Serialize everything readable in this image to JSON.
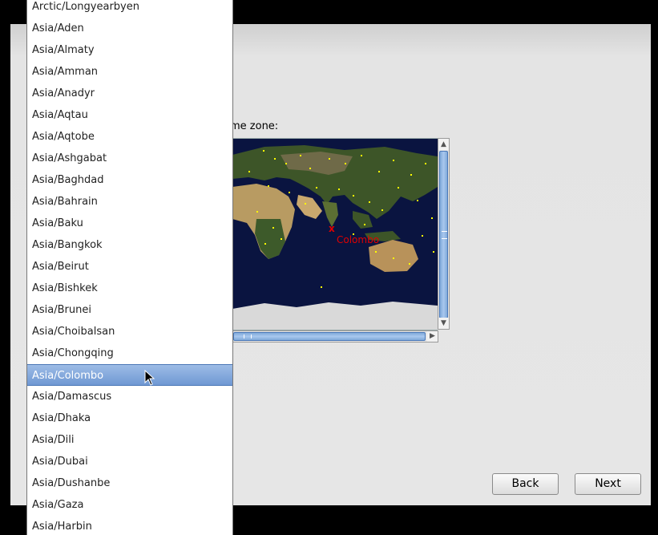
{
  "timezone_label": "me zone:",
  "map": {
    "selected_city": "Colombo",
    "marker": "x"
  },
  "buttons": {
    "back": "Back",
    "next": "Next"
  },
  "dropdown": {
    "selected_index": 17,
    "items": [
      "Arctic/Longyearbyen",
      "Asia/Aden",
      "Asia/Almaty",
      "Asia/Amman",
      "Asia/Anadyr",
      "Asia/Aqtau",
      "Asia/Aqtobe",
      "Asia/Ashgabat",
      "Asia/Baghdad",
      "Asia/Bahrain",
      "Asia/Baku",
      "Asia/Bangkok",
      "Asia/Beirut",
      "Asia/Bishkek",
      "Asia/Brunei",
      "Asia/Choibalsan",
      "Asia/Chongqing",
      "Asia/Colombo",
      "Asia/Damascus",
      "Asia/Dhaka",
      "Asia/Dili",
      "Asia/Dubai",
      "Asia/Dushanbe",
      "Asia/Gaza",
      "Asia/Harbin"
    ]
  },
  "colors": {
    "selection": "#6f98d3",
    "map_ocean": "#0a1440",
    "city_dot": "#ffff00",
    "marker": "#e00000"
  },
  "icons": {
    "scroll_up": "▲",
    "scroll_down": "▼",
    "scroll_right": "▶",
    "cursor": "arrow-cursor-icon"
  }
}
